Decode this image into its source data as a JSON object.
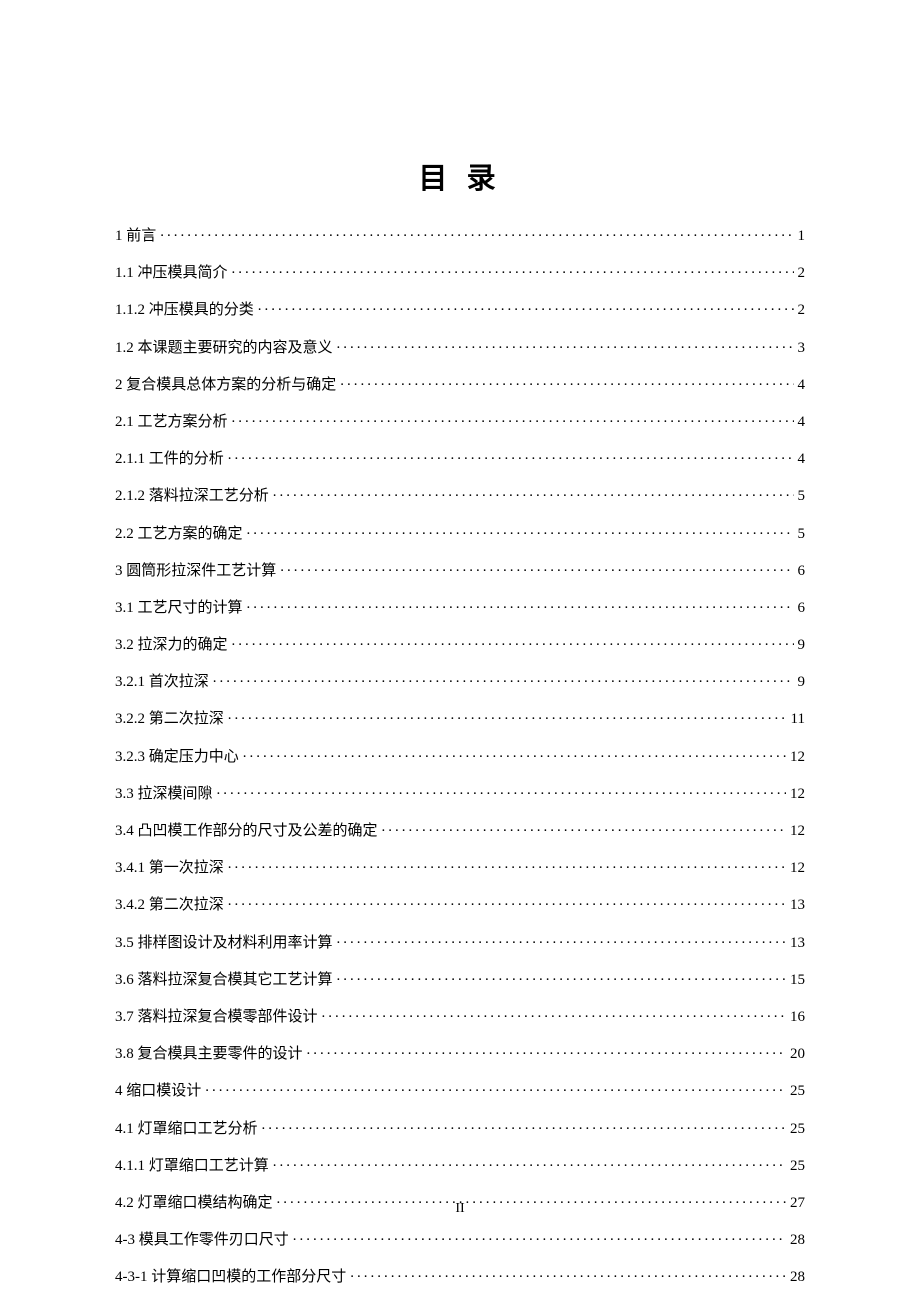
{
  "title": "目 录",
  "footer": "II",
  "toc": [
    {
      "label": "1 前言",
      "page": "1"
    },
    {
      "label": "1.1 冲压模具简介",
      "page": "2"
    },
    {
      "label": "1.1.2 冲压模具的分类",
      "page": "2"
    },
    {
      "label": "1.2 本课题主要研究的内容及意义",
      "page": "3"
    },
    {
      "label": "2 复合模具总体方案的分析与确定",
      "page": "4"
    },
    {
      "label": "2.1 工艺方案分析",
      "page": "4"
    },
    {
      "label": "2.1.1 工件的分析",
      "page": "4"
    },
    {
      "label": "2.1.2  落料拉深工艺分析",
      "page": "5"
    },
    {
      "label": "2.2 工艺方案的确定",
      "page": "5"
    },
    {
      "label": "3 圆筒形拉深件工艺计算",
      "page": "6"
    },
    {
      "label": "3.1  工艺尺寸的计算",
      "page": "6"
    },
    {
      "label": "3.2 拉深力的确定",
      "page": "9"
    },
    {
      "label": "3.2.1 首次拉深",
      "page": "9"
    },
    {
      "label": "3.2.2 第二次拉深",
      "page": "11"
    },
    {
      "label": "3.2.3 确定压力中心",
      "page": "12"
    },
    {
      "label": "3.3  拉深模间隙",
      "page": "12"
    },
    {
      "label": "3.4  凸凹模工作部分的尺寸及公差的确定",
      "page": "12"
    },
    {
      "label": "3.4.1 第一次拉深",
      "page": "12"
    },
    {
      "label": "3.4.2 第二次拉深",
      "page": "13"
    },
    {
      "label": "3.5 排样图设计及材料利用率计算",
      "page": "13"
    },
    {
      "label": "3.6 落料拉深复合模其它工艺计算",
      "page": "15"
    },
    {
      "label": "3.7 落料拉深复合模零部件设计",
      "page": "16"
    },
    {
      "label": "3.8  复合模具主要零件的设计",
      "page": "20"
    },
    {
      "label": "4  缩口模设计",
      "page": "25"
    },
    {
      "label": "4.1 灯罩缩口工艺分析",
      "page": "25"
    },
    {
      "label": "4.1.1 灯罩缩口工艺计算",
      "page": "25"
    },
    {
      "label": "4.2  灯罩缩口模结构确定",
      "page": "27"
    },
    {
      "label": "4-3 模具工作零件刃口尺寸",
      "page": "28"
    },
    {
      "label": "4-3-1 计算缩口凹模的工作部分尺寸",
      "page": "28"
    }
  ]
}
